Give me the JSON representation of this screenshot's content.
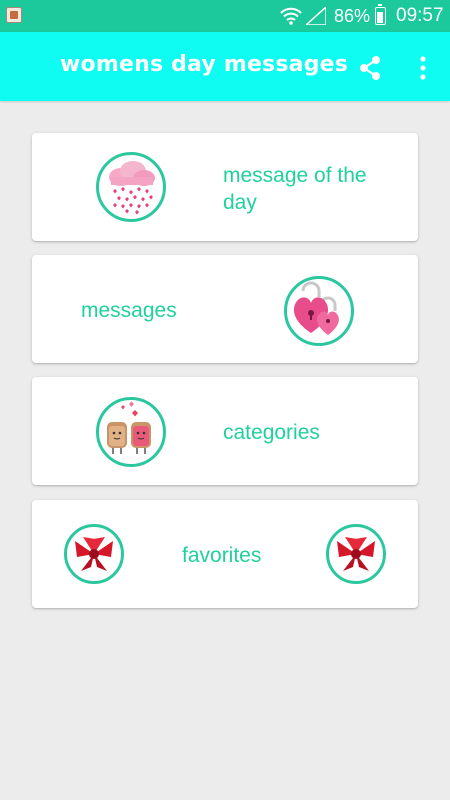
{
  "status_bar": {
    "battery_percent": "86%",
    "time": "09:57"
  },
  "app_bar": {
    "title": "womens day messages",
    "share_icon": "share-icon",
    "more_icon": "more-vert-icon"
  },
  "menu": [
    {
      "label": "message of the day",
      "icon": "cloud-hearts-icon"
    },
    {
      "label": "messages",
      "icon": "heart-locks-icon"
    },
    {
      "label": "categories",
      "icon": "toast-couple-icon"
    },
    {
      "label": "favorites",
      "icon": "red-bow-icon"
    }
  ],
  "colors": {
    "status_bar": "#1cc99c",
    "app_bar": "#0ffcf3",
    "accent_text": "#21d19c",
    "badge_border": "#2bc89f",
    "background": "#ececec"
  }
}
